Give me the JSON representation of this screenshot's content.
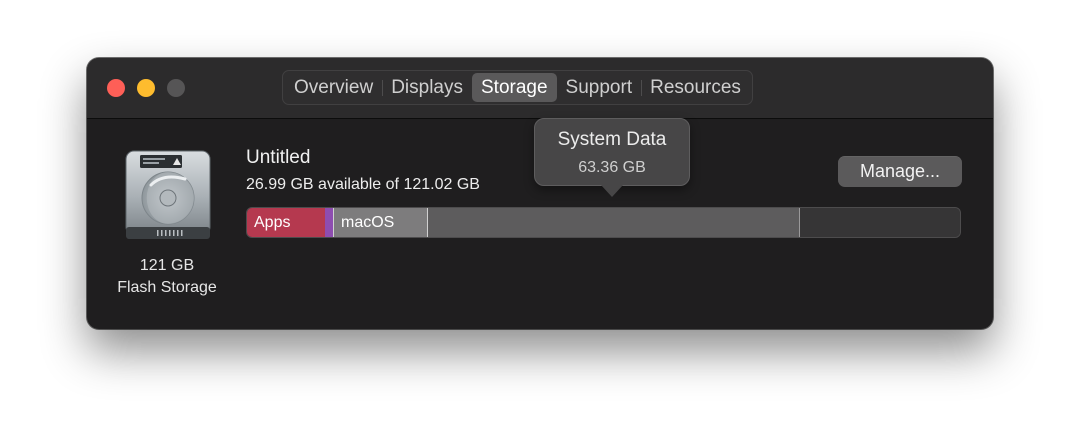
{
  "window": {
    "tabs": [
      {
        "label": "Overview",
        "active": false
      },
      {
        "label": "Displays",
        "active": false
      },
      {
        "label": "Storage",
        "active": true
      },
      {
        "label": "Support",
        "active": false
      },
      {
        "label": "Resources",
        "active": false
      }
    ]
  },
  "drive": {
    "capacity": "121 GB",
    "type": "Flash Storage",
    "icon": "hard-drive-icon"
  },
  "volume": {
    "name": "Untitled",
    "availability": "26.99 GB available of 121.02 GB"
  },
  "storage_bar": {
    "segments": [
      {
        "label": "Apps",
        "color": "#b5394f"
      },
      {
        "label": "",
        "color": "#8e4db0"
      },
      {
        "label": "macOS",
        "color": "#7d7c7d"
      },
      {
        "label": "",
        "color": "#5d5c5d"
      },
      {
        "label": "",
        "color": "#363536"
      }
    ]
  },
  "tooltip": {
    "title": "System Data",
    "value": "63.36 GB"
  },
  "buttons": {
    "manage_label": "Manage..."
  },
  "colors": {
    "close": "#fe5f57",
    "minimize": "#febc2e",
    "zoom": "#565556",
    "window_bg": "#1f1e1f"
  }
}
